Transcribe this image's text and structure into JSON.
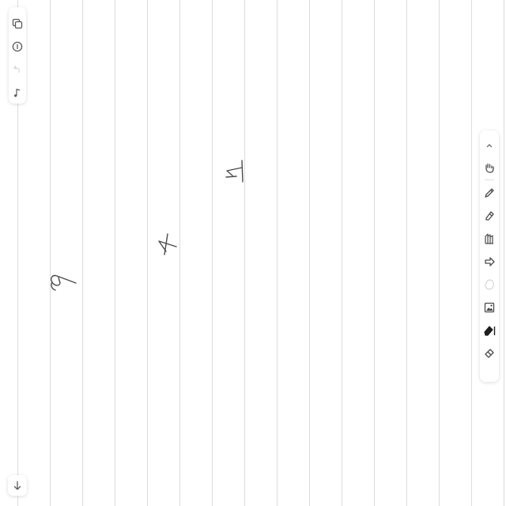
{
  "canvas": {
    "background": "#ffffff",
    "rule_color": "#dcdcdc",
    "ink_color": "#4a4a4a"
  },
  "left_toolbar": {
    "items": [
      {
        "icon": "copy-icon",
        "enabled": true
      },
      {
        "icon": "info-icon",
        "enabled": true
      },
      {
        "icon": "undo-icon",
        "enabled": false
      },
      {
        "icon": "music-note-icon",
        "enabled": true
      }
    ]
  },
  "right_toolbar": {
    "items": [
      {
        "icon": "chevron-up-icon"
      },
      {
        "icon": "hand-icon"
      },
      {
        "icon": "pen-icon"
      },
      {
        "icon": "highlighter-icon"
      },
      {
        "icon": "brush-icon"
      },
      {
        "icon": "shape-icon"
      },
      {
        "icon": "lasso-icon"
      },
      {
        "icon": "image-icon"
      },
      {
        "icon": "eraser-active-icon",
        "active": true
      },
      {
        "icon": "eraser-icon"
      }
    ]
  },
  "handwriting": [
    "9",
    "4",
    "1"
  ],
  "scroll": {
    "icon": "arrow-down-icon"
  }
}
